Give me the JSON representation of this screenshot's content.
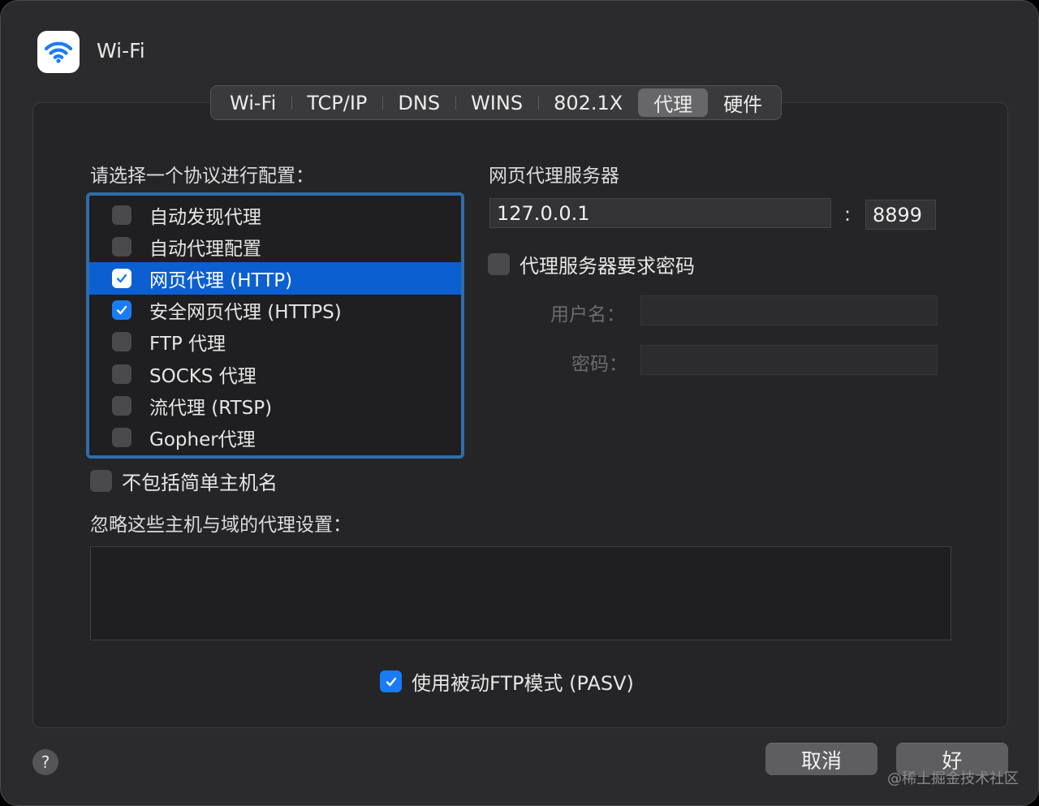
{
  "window": {
    "title": "Wi-Fi",
    "icon": "wifi-icon"
  },
  "tabs": [
    {
      "label": "Wi-Fi",
      "active": false
    },
    {
      "label": "TCP/IP",
      "active": false
    },
    {
      "label": "DNS",
      "active": false
    },
    {
      "label": "WINS",
      "active": false
    },
    {
      "label": "802.1X",
      "active": false
    },
    {
      "label": "代理",
      "active": true
    },
    {
      "label": "硬件",
      "active": false
    }
  ],
  "protocols": {
    "heading": "请选择一个协议进行配置：",
    "items": [
      {
        "label": "自动发现代理",
        "checked": false,
        "selected": false
      },
      {
        "label": "自动代理配置",
        "checked": false,
        "selected": false
      },
      {
        "label": "网页代理 (HTTP)",
        "checked": true,
        "selected": true
      },
      {
        "label": "安全网页代理 (HTTPS)",
        "checked": true,
        "selected": false
      },
      {
        "label": "FTP 代理",
        "checked": false,
        "selected": false
      },
      {
        "label": "SOCKS 代理",
        "checked": false,
        "selected": false
      },
      {
        "label": "流代理 (RTSP)",
        "checked": false,
        "selected": false
      },
      {
        "label": "Gopher代理",
        "checked": false,
        "selected": false
      }
    ]
  },
  "server": {
    "heading": "网页代理服务器",
    "host": "127.0.0.1",
    "separator": ":",
    "port": "8899",
    "requires_password_label": "代理服务器要求密码",
    "requires_password": false,
    "username_label": "用户名：",
    "password_label": "密码："
  },
  "exclude_simple": {
    "label": "不包括简单主机名",
    "checked": false
  },
  "bypass": {
    "heading": "忽略这些主机与域的代理设置："
  },
  "pasv": {
    "label": "使用被动FTP模式 (PASV)",
    "checked": true
  },
  "buttons": {
    "help": "?",
    "cancel": "取消",
    "ok": "好"
  },
  "watermark": "@稀土掘金技术社区",
  "colors": {
    "accent": "#1a7cf5",
    "selection": "#0c5fd1",
    "focus_ring": "#2f6ea8"
  }
}
